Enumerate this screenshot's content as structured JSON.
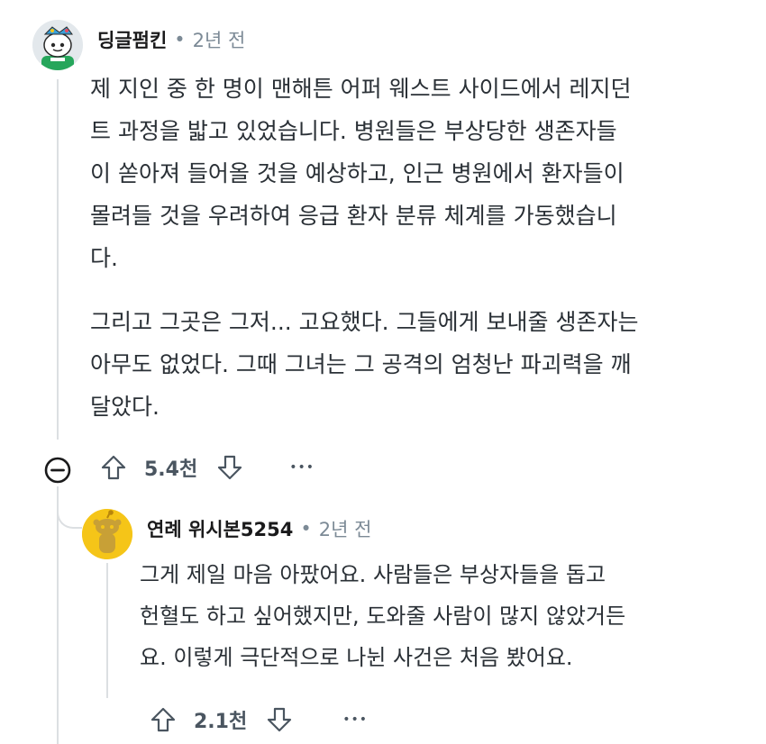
{
  "comment1": {
    "username": "딩글펌킨",
    "separator": "•",
    "time": "2년 전",
    "paragraphs": [
      [
        "제 지인 중 한 명이 맨해튼 어퍼 웨스트 사이드에서 레지던",
        "트 과정을 밟고 있었습니다. 병원들은 부상당한 생존자들",
        "이 쏟아져 들어올 것을 예상하고, 인근 병원에서 환자들이",
        "몰려들 것을 우려하여 응급 환자 분류 체계를 가동했습니",
        "다."
      ],
      [
        "그리고 그곳은 그저... 고요했다. 그들에게 보내줄 생존자는",
        "아무도 없었다. 그때 그녀는 그 공격의 엄청난 파괴력을 깨",
        "달았다."
      ]
    ],
    "vote_count": "5.4천",
    "more": "•••",
    "icons": {
      "collapse": "collapse-minus-icon",
      "upvote": "upvote-arrow-icon",
      "downvote": "downvote-arrow-icon",
      "more": "more-options-icon"
    }
  },
  "comment2": {
    "username": "연례 위시본5254",
    "separator": "•",
    "time": "2년 전",
    "lines": [
      "그게 제일 마음 아팠어요. 사람들은 부상자들을 돕고",
      "헌혈도 하고 싶어했지만, 도와줄 사람이 많지 않았거든",
      "요. 이렇게 극단적으로 나뉜 사건은 처음 봤어요."
    ],
    "vote_count": "2.1천",
    "more": "•••"
  },
  "colors": {
    "muted": "#7c8a96",
    "text": "#2a3036",
    "thread": "#dcdfe2",
    "avatar_yellow": "#f5c518"
  }
}
